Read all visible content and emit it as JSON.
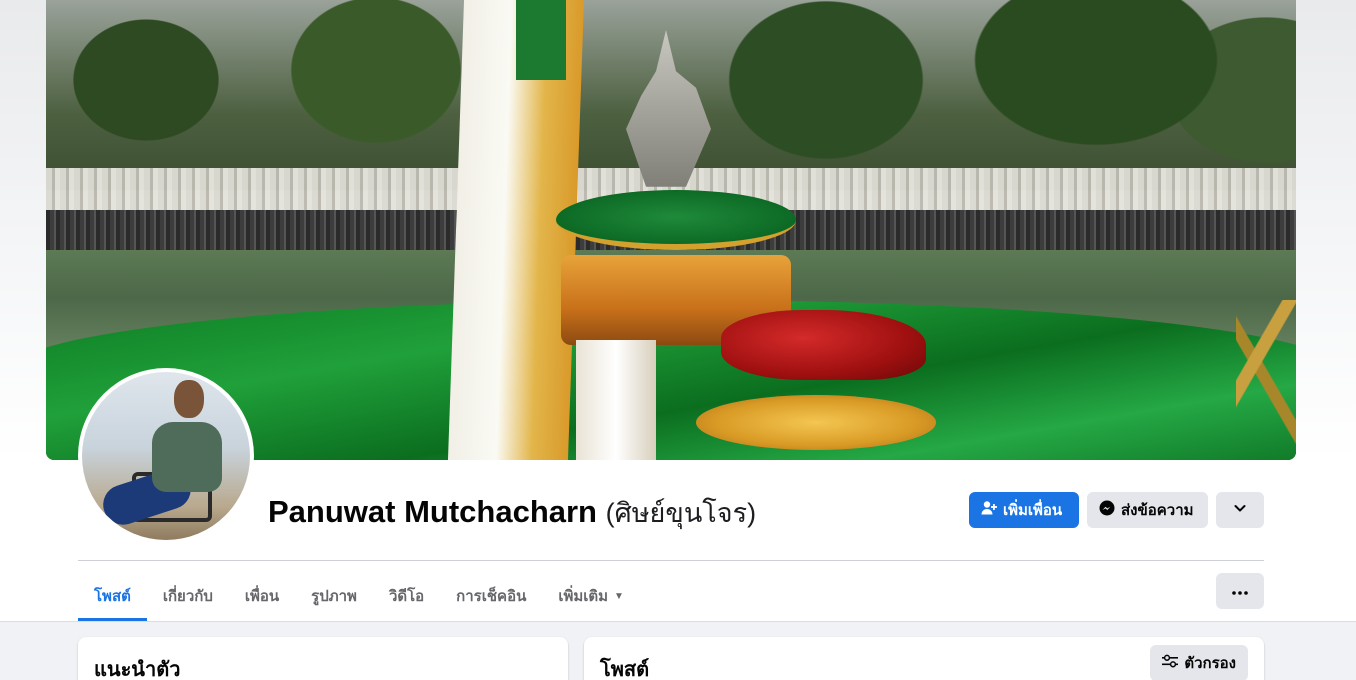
{
  "profile": {
    "name": "Panuwat Mutchacharn",
    "alternate_name": "(ศิษย์ขุนโจร)"
  },
  "actions": {
    "add_friend_label": "เพิ่มเพื่อน",
    "message_label": "ส่งข้อความ",
    "dropdown_icon": "chevron-down-icon"
  },
  "tabs": [
    {
      "label": "โพสต์",
      "active": true
    },
    {
      "label": "เกี่ยวกับ",
      "active": false
    },
    {
      "label": "เพื่อน",
      "active": false
    },
    {
      "label": "รูปภาพ",
      "active": false
    },
    {
      "label": "วิดีโอ",
      "active": false
    },
    {
      "label": "การเช็คอิน",
      "active": false
    },
    {
      "label": "เพิ่มเติม",
      "active": false
    }
  ],
  "intro": {
    "title": "แนะนำตัว"
  },
  "posts": {
    "title": "โพสต์",
    "filter_label": "ตัวกรอง"
  },
  "colors": {
    "accent": "#1b74e4",
    "secondary_button": "#e4e6eb",
    "feed_background": "#f0f2f5"
  }
}
